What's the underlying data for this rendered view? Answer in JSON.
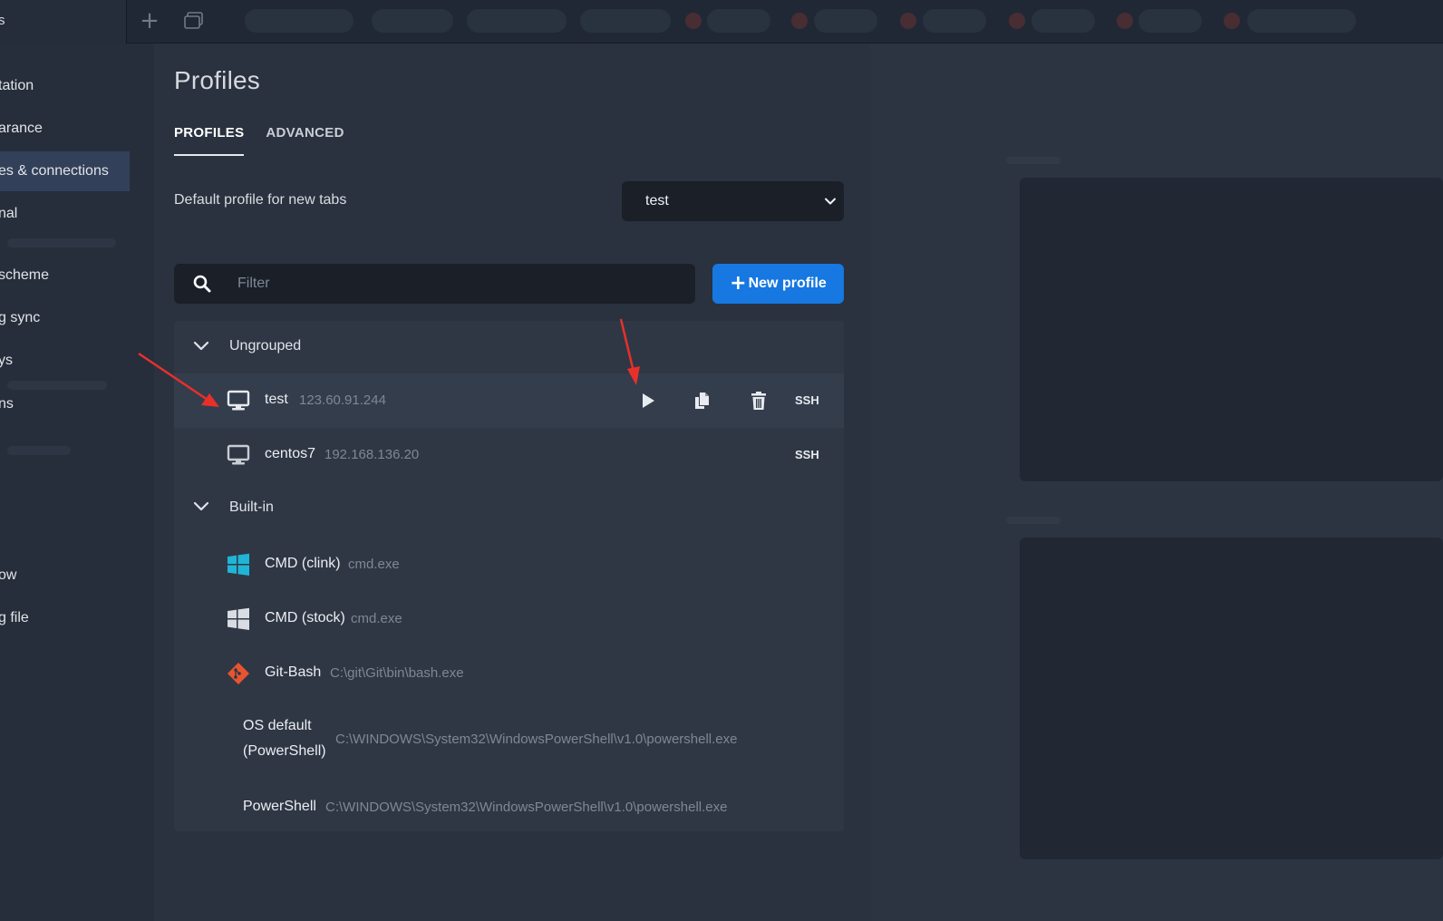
{
  "topbar": {
    "left_label": "s",
    "new_tab_icon": "plus-icon",
    "windows_icon": "window-icon"
  },
  "sidebar": {
    "items": [
      {
        "label": "tation"
      },
      {
        "label": "arance"
      },
      {
        "label": "es & connections",
        "active": true
      },
      {
        "label": "nal"
      },
      {
        "label": "scheme"
      },
      {
        "label": "g sync"
      },
      {
        "label": "ys"
      },
      {
        "label": "ns"
      },
      {
        "label": "ow"
      },
      {
        "label": "g file"
      }
    ]
  },
  "page": {
    "title": "Profiles",
    "tabs": [
      {
        "label": "PROFILES",
        "active": true
      },
      {
        "label": "ADVANCED",
        "active": false
      }
    ],
    "default_profile_label": "Default profile for new tabs",
    "default_profile_value": "test",
    "filter_placeholder": "Filter",
    "new_profile_label": "New profile"
  },
  "groups": [
    {
      "name": "Ungrouped",
      "profiles": [
        {
          "name": "test",
          "detail": "123.60.91.244",
          "badge": "SSH",
          "icon": "monitor-icon",
          "hovered": true
        },
        {
          "name": "centos7",
          "detail": "192.168.136.20",
          "badge": "SSH",
          "icon": "monitor-icon"
        }
      ]
    },
    {
      "name": "Built-in",
      "profiles": [
        {
          "name": "CMD (clink)",
          "detail": "cmd.exe",
          "icon": "windows-logo-icon",
          "color": "#1fb5d6"
        },
        {
          "name": "CMD (stock)",
          "detail": "cmd.exe",
          "icon": "windows-logo-icon",
          "color": "#d9dde3"
        },
        {
          "name": "Git-Bash",
          "detail": "C:\\git\\Git\\bin\\bash.exe",
          "icon": "git-icon",
          "color": "#e8542f"
        },
        {
          "name": "OS default (PowerShell)",
          "name_line1": "OS default",
          "name_line2": "(PowerShell)",
          "detail": "C:\\WINDOWS\\System32\\WindowsPowerShell\\v1.0\\powershell.exe"
        },
        {
          "name": "PowerShell",
          "detail": "C:\\WINDOWS\\System32\\WindowsPowerShell\\v1.0\\powershell.exe"
        }
      ]
    }
  ],
  "colors": {
    "accent": "#1678e0",
    "annotation_arrow": "#e8302a"
  }
}
